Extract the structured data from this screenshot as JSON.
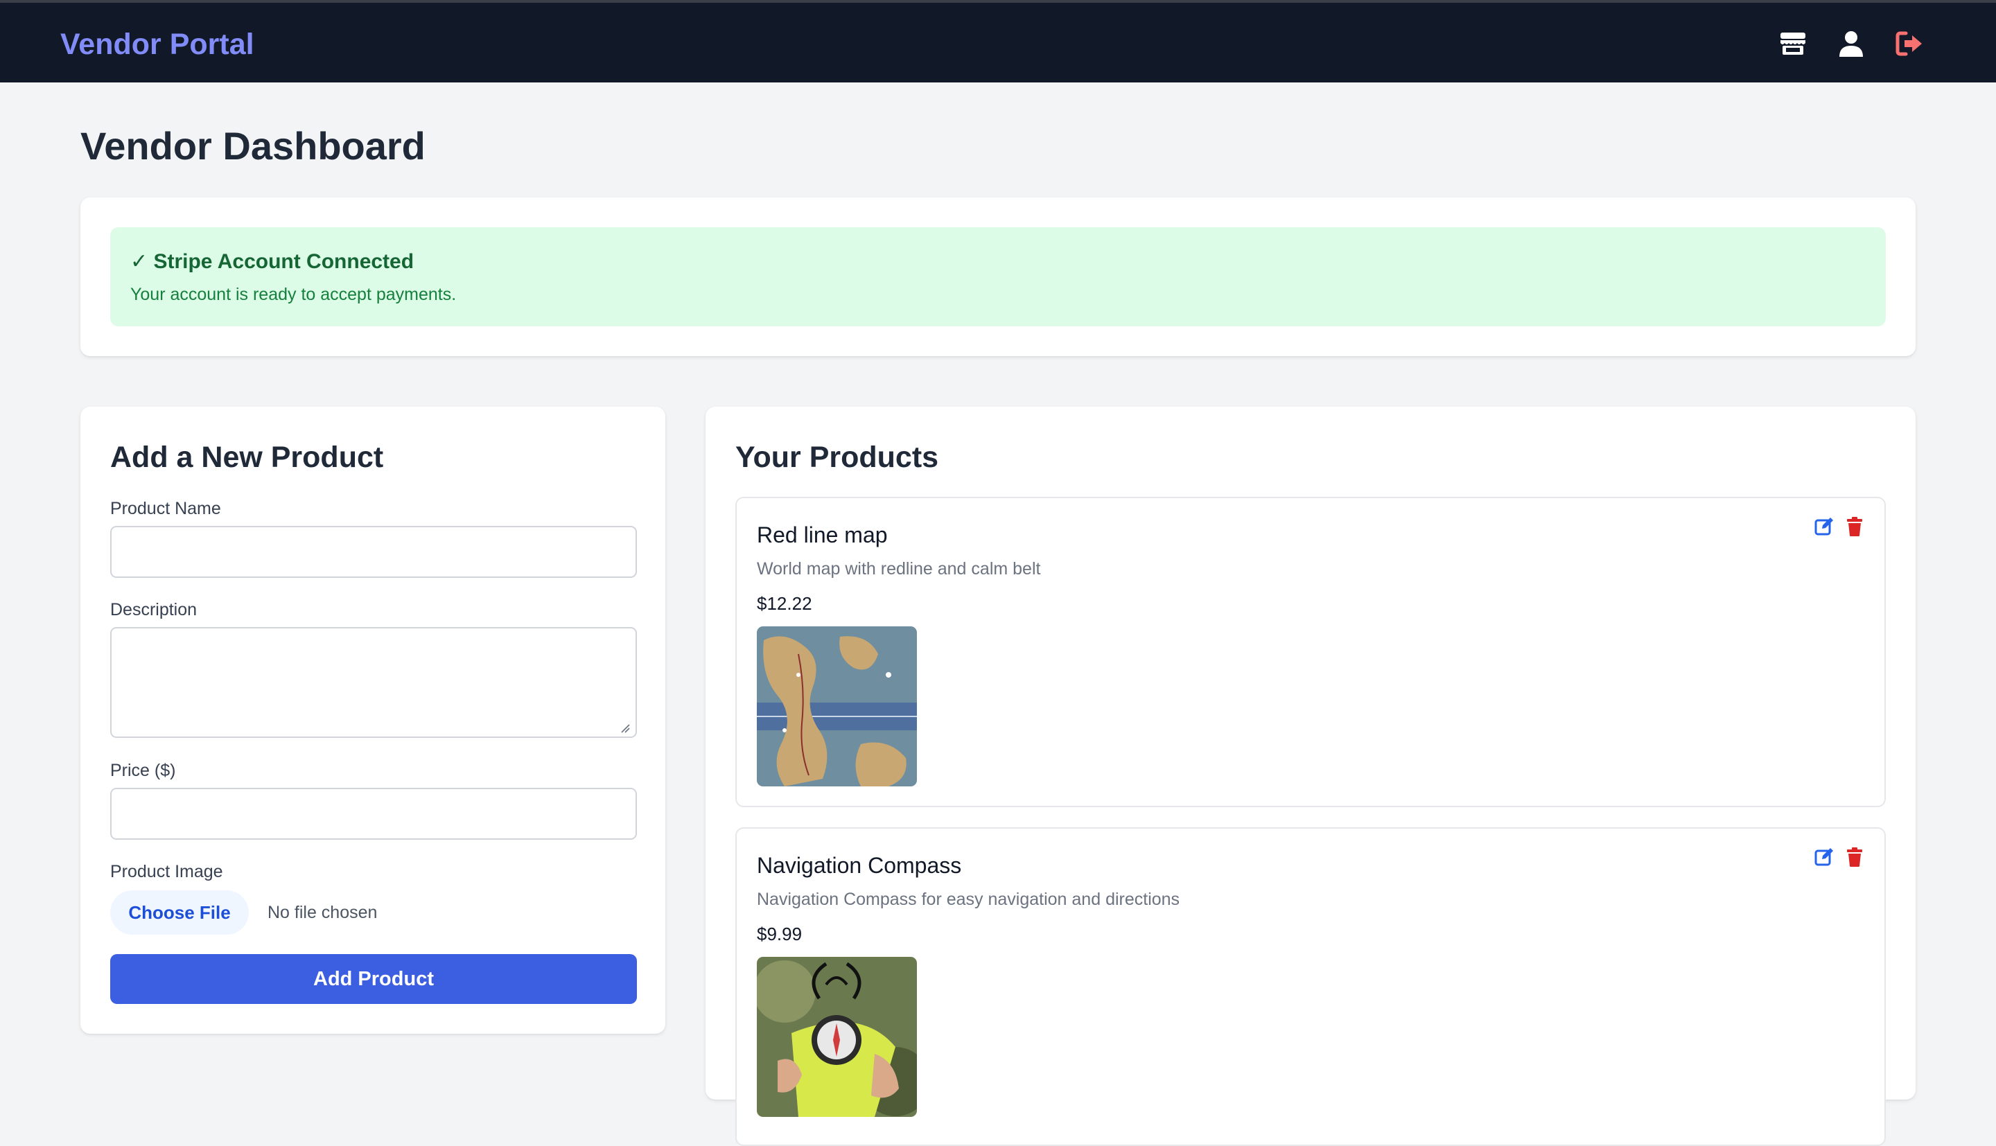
{
  "app": {
    "brand": "Vendor Portal"
  },
  "nav": {
    "icons": [
      "store-icon",
      "user-icon",
      "sign-out-icon"
    ],
    "colors": {
      "bar": "#111827",
      "brand": "#818cf8",
      "signout": "#f87171"
    }
  },
  "page": {
    "title": "Vendor Dashboard"
  },
  "stripe": {
    "title": "✓ Stripe Account Connected",
    "message": "Your account is ready to accept payments."
  },
  "add_product": {
    "heading": "Add a New Product",
    "name_label": "Product Name",
    "name_value": "",
    "description_label": "Description",
    "description_value": "",
    "price_label": "Price ($)",
    "price_value": "",
    "image_label": "Product Image",
    "choose_file_label": "Choose File",
    "file_status": "No file chosen",
    "submit_label": "Add Product"
  },
  "products": {
    "heading": "Your Products",
    "items": [
      {
        "name": "Red line map",
        "description": "World map with redline and calm belt",
        "price": "$12.22",
        "image": "map-thumbnail"
      },
      {
        "name": "Navigation Compass",
        "description": "Navigation Compass for easy navigation and directions",
        "price": "$9.99",
        "image": "compass-thumbnail"
      }
    ],
    "action_icons": [
      "edit-icon",
      "trash-icon"
    ]
  },
  "colors": {
    "accent": "#3b5fe0",
    "success_bg": "#dcfce7",
    "success_text": "#166534",
    "edit": "#2563eb",
    "delete": "#dc2626"
  }
}
